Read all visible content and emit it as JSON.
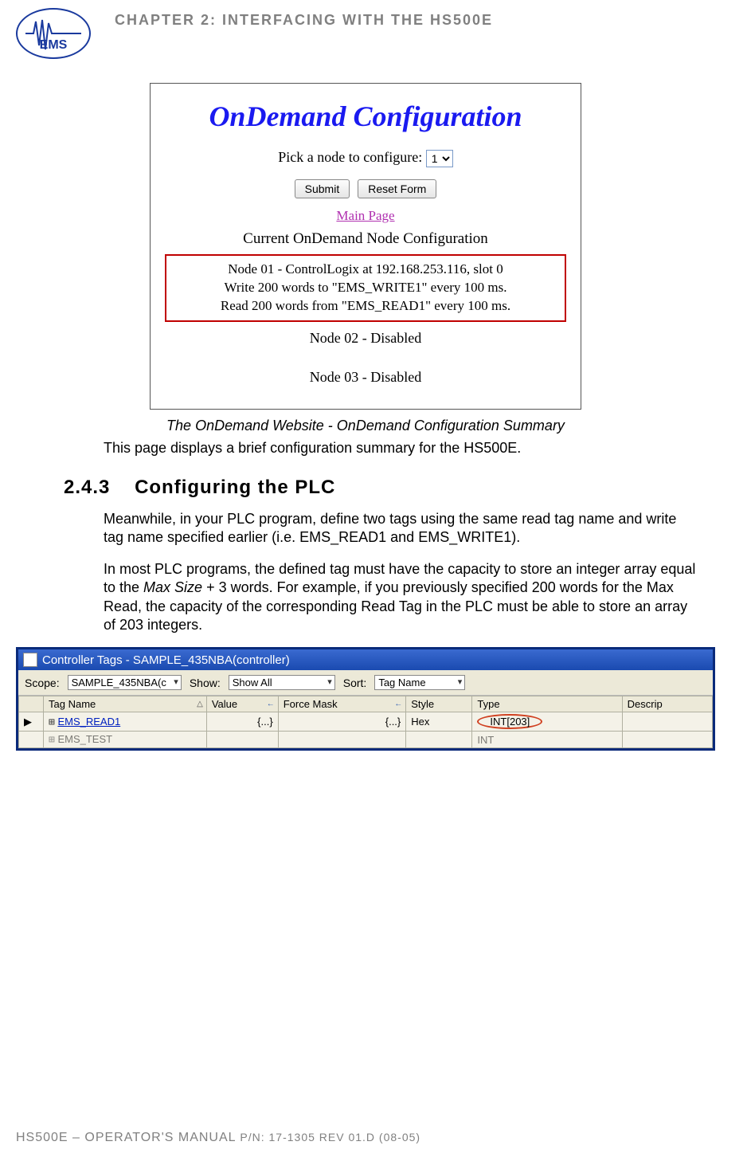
{
  "header": {
    "chapter": "CHAPTER 2: INTERFACING WITH THE HS500E",
    "logo_text": "EMS"
  },
  "ondemand": {
    "title": "OnDemand Configuration",
    "pick_label": "Pick a node to configure:",
    "selected_node": "1",
    "submit": "Submit",
    "reset": "Reset Form",
    "main_page": "Main Page",
    "subhead": "Current OnDemand Node Configuration",
    "node01_line1": "Node 01 - ControlLogix at 192.168.253.116, slot 0",
    "node01_line2": "Write 200 words to \"EMS_WRITE1\" every 100 ms.",
    "node01_line3": "Read 200 words from \"EMS_READ1\" every 100 ms.",
    "node02": "Node 02 - Disabled",
    "node03": "Node 03 - Disabled"
  },
  "caption": "The OnDemand Website - OnDemand Configuration Summary",
  "intro_text": "This page displays a brief configuration summary for the HS500E.",
  "section": {
    "number": "2.4.3",
    "title": "Configuring the PLC"
  },
  "para1_a": "Meanwhile, in your PLC program, define two tags using the same read tag name and write tag name specified earlier (i.e. EMS_READ1 and EMS_WRITE1).",
  "para2_a": "In most PLC programs, the defined tag must have the capacity to store an integer array equal to the ",
  "para2_em": "Max Size",
  "para2_b": " + 3 words. For example, if you previously specified 200 words for the Max Read, the capacity of the corresponding Read Tag in the PLC must be able to store an array of 203 integers.",
  "plc": {
    "title": "Controller Tags - SAMPLE_435NBA(controller)",
    "scope_label": "Scope:",
    "scope_value": "SAMPLE_435NBA(c",
    "show_label": "Show:",
    "show_value": "Show All",
    "sort_label": "Sort:",
    "sort_value": "Tag Name",
    "columns": {
      "tag_name": "Tag Name",
      "value": "Value",
      "force_mask": "Force Mask",
      "style": "Style",
      "type": "Type",
      "descrip": "Descrip"
    },
    "rows": [
      {
        "tag": "EMS_READ1",
        "value": "{...}",
        "force": "{...}",
        "style": "Hex",
        "type": "INT[203]"
      },
      {
        "tag": "EMS_TEST",
        "value": "",
        "force": "",
        "style": "",
        "type": "INT"
      }
    ]
  },
  "footer": {
    "main": "HS500E – OPERATOR'S MANUAL ",
    "pn": "P/N: 17-1305 REV 01.D (08-05)"
  }
}
